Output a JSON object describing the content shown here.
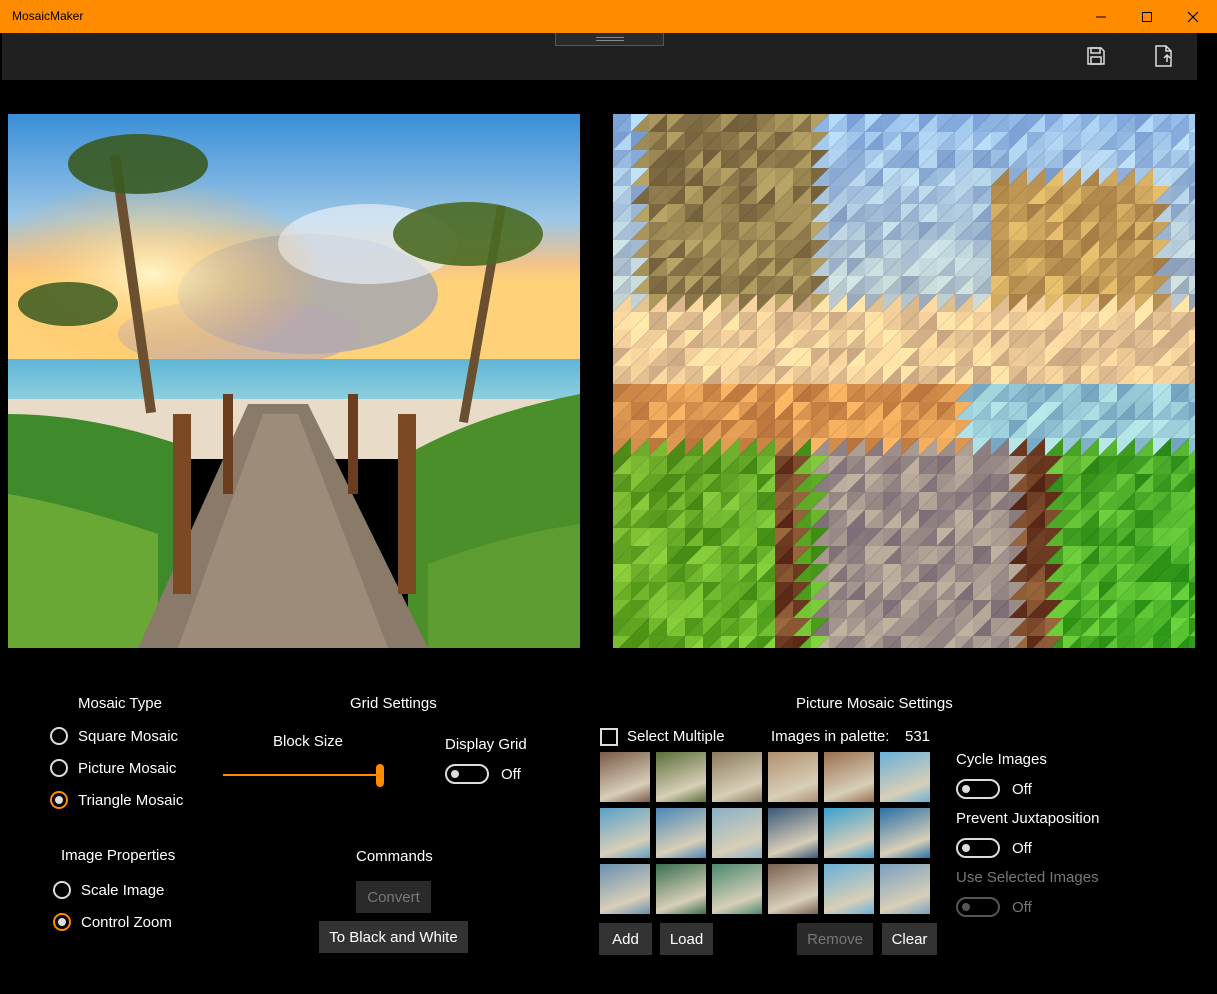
{
  "window": {
    "title": "MosaicMaker"
  },
  "colors": {
    "accent": "#ff8c00",
    "titlebar": "#ff8c00",
    "appbar": "#202020",
    "background": "#000000"
  },
  "appbar": {
    "icons": [
      "save-icon",
      "export-file-icon"
    ]
  },
  "mosaic_type": {
    "heading": "Mosaic Type",
    "options": [
      {
        "label": "Square Mosaic",
        "selected": false
      },
      {
        "label": "Picture Mosaic",
        "selected": false
      },
      {
        "label": "Triangle Mosaic",
        "selected": true
      }
    ]
  },
  "image_properties": {
    "heading": "Image Properties",
    "options": [
      {
        "label": "Scale Image",
        "selected": false
      },
      {
        "label": "Control Zoom",
        "selected": true
      }
    ]
  },
  "grid_settings": {
    "heading": "Grid Settings",
    "block_size_label": "Block Size",
    "block_size_value": 1.0,
    "display_grid_label": "Display Grid",
    "display_grid_state": "Off"
  },
  "commands": {
    "heading": "Commands",
    "convert_label": "Convert",
    "bw_label": "To Black and White"
  },
  "picture_mosaic": {
    "heading": "Picture Mosaic Settings",
    "select_multiple_label": "Select Multiple",
    "images_in_palette_label": "Images in palette:",
    "images_in_palette_count": "531",
    "add_label": "Add",
    "load_label": "Load",
    "remove_label": "Remove",
    "clear_label": "Clear",
    "cycle_images_label": "Cycle Images",
    "cycle_images_state": "Off",
    "prevent_juxtaposition_label": "Prevent Juxtaposition",
    "prevent_juxtaposition_state": "Off",
    "use_selected_label": "Use Selected Images",
    "use_selected_state": "Off",
    "thumbnail_colors": [
      [
        "#7a5a4a",
        "#5c6e3a",
        "#8a7a5a",
        "#b09070",
        "#9a7050",
        "#6ab0d8"
      ],
      [
        "#5aa0c8",
        "#4a88b8",
        "#8ab0c8",
        "#3a5878",
        "#3aa0d0",
        "#2a70a8"
      ],
      [
        "#6a90b0",
        "#3a7050",
        "#4a8a70",
        "#7a6050",
        "#6ab0d8",
        "#7aa0c0"
      ]
    ]
  }
}
